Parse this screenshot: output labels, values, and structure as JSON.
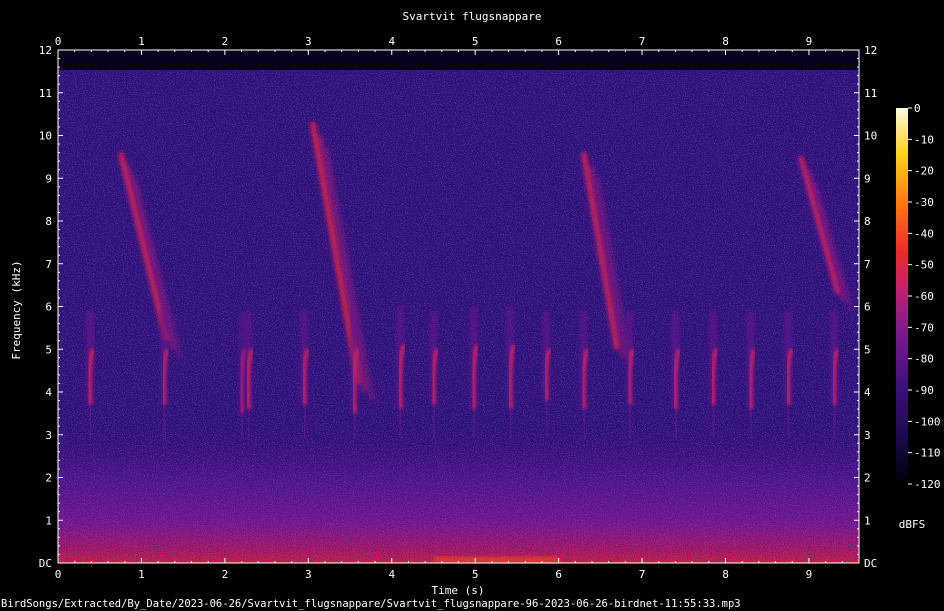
{
  "chart_data": {
    "type": "heatmap",
    "title": "Svartvit flugsnappare",
    "xlabel": "Time (s)",
    "ylabel": "Frequency (kHz)",
    "xlim": [
      0,
      9.6
    ],
    "ylim": [
      0,
      12
    ],
    "x_ticks": [
      "0",
      "1",
      "2",
      "3",
      "4",
      "5",
      "6",
      "7",
      "8",
      "9"
    ],
    "y_ticks": [
      "DC",
      "1",
      "2",
      "3",
      "4",
      "5",
      "6",
      "7",
      "8",
      "9",
      "10",
      "11",
      "12"
    ],
    "colorbar": {
      "label": "dBFS",
      "range": [
        -120,
        0
      ],
      "ticks": [
        "0",
        "-10",
        "-20",
        "-30",
        "-40",
        "-50",
        "-60",
        "-70",
        "-80",
        "-90",
        "-100",
        "-110",
        "-120"
      ],
      "colors": [
        "#000000",
        "#1a0a4a",
        "#3a0f7a",
        "#7a1a90",
        "#c4206f",
        "#ee2b2b",
        "#ff7a10",
        "#ffd21e",
        "#fffbe0"
      ]
    },
    "background_db": -95,
    "calls": [
      {
        "type": "sweep",
        "t": 0.75,
        "f_start": 9.6,
        "f_end": 5.2,
        "dur": 0.55,
        "db": -58
      },
      {
        "type": "sweep",
        "t": 3.05,
        "f_start": 10.3,
        "f_end": 4.2,
        "dur": 0.55,
        "db": -55
      },
      {
        "type": "sweep",
        "t": 6.3,
        "f_start": 9.6,
        "f_end": 5.0,
        "dur": 0.4,
        "db": -58
      },
      {
        "type": "sweep",
        "t": 8.9,
        "f_start": 9.5,
        "f_end": 6.3,
        "dur": 0.45,
        "db": -60
      },
      {
        "type": "note",
        "t": 0.38,
        "f_top": 5.9,
        "f_bottom": 3.7,
        "db": -60
      },
      {
        "type": "note",
        "t": 1.27,
        "f_top": 5.9,
        "f_bottom": 3.7,
        "db": -62
      },
      {
        "type": "note",
        "t": 2.2,
        "f_top": 5.9,
        "f_bottom": 3.5,
        "db": -66
      },
      {
        "type": "note",
        "t": 2.28,
        "f_top": 5.9,
        "f_bottom": 3.6,
        "db": -62
      },
      {
        "type": "note",
        "t": 2.95,
        "f_top": 5.9,
        "f_bottom": 3.7,
        "db": -62
      },
      {
        "type": "note",
        "t": 3.55,
        "f_top": 5.9,
        "f_bottom": 3.5,
        "db": -62
      },
      {
        "type": "note",
        "t": 4.1,
        "f_top": 6.0,
        "f_bottom": 3.6,
        "db": -62
      },
      {
        "type": "note",
        "t": 4.5,
        "f_top": 5.9,
        "f_bottom": 3.7,
        "db": -62
      },
      {
        "type": "note",
        "t": 4.98,
        "f_top": 6.0,
        "f_bottom": 3.6,
        "db": -62
      },
      {
        "type": "note",
        "t": 5.42,
        "f_top": 6.0,
        "f_bottom": 3.6,
        "db": -62
      },
      {
        "type": "note",
        "t": 5.85,
        "f_top": 5.9,
        "f_bottom": 3.8,
        "db": -62
      },
      {
        "type": "note",
        "t": 6.3,
        "f_top": 5.9,
        "f_bottom": 3.6,
        "db": -62
      },
      {
        "type": "note",
        "t": 6.85,
        "f_top": 5.9,
        "f_bottom": 3.7,
        "db": -62
      },
      {
        "type": "note",
        "t": 7.4,
        "f_top": 5.9,
        "f_bottom": 3.6,
        "db": -62
      },
      {
        "type": "note",
        "t": 7.85,
        "f_top": 5.9,
        "f_bottom": 3.7,
        "db": -62
      },
      {
        "type": "note",
        "t": 8.3,
        "f_top": 5.9,
        "f_bottom": 3.6,
        "db": -62
      },
      {
        "type": "note",
        "t": 8.75,
        "f_top": 5.9,
        "f_bottom": 3.7,
        "db": -62
      },
      {
        "type": "note",
        "t": 9.3,
        "f_top": 5.9,
        "f_bottom": 3.7,
        "db": -62
      }
    ]
  },
  "footer": {
    "file_path": "BirdSongs/Extracted/By_Date/2023-06-26/Svartvit_flugsnappare/Svartvit_flugsnappare-96-2023-06-26-birdnet-11:55:33.mp3"
  }
}
